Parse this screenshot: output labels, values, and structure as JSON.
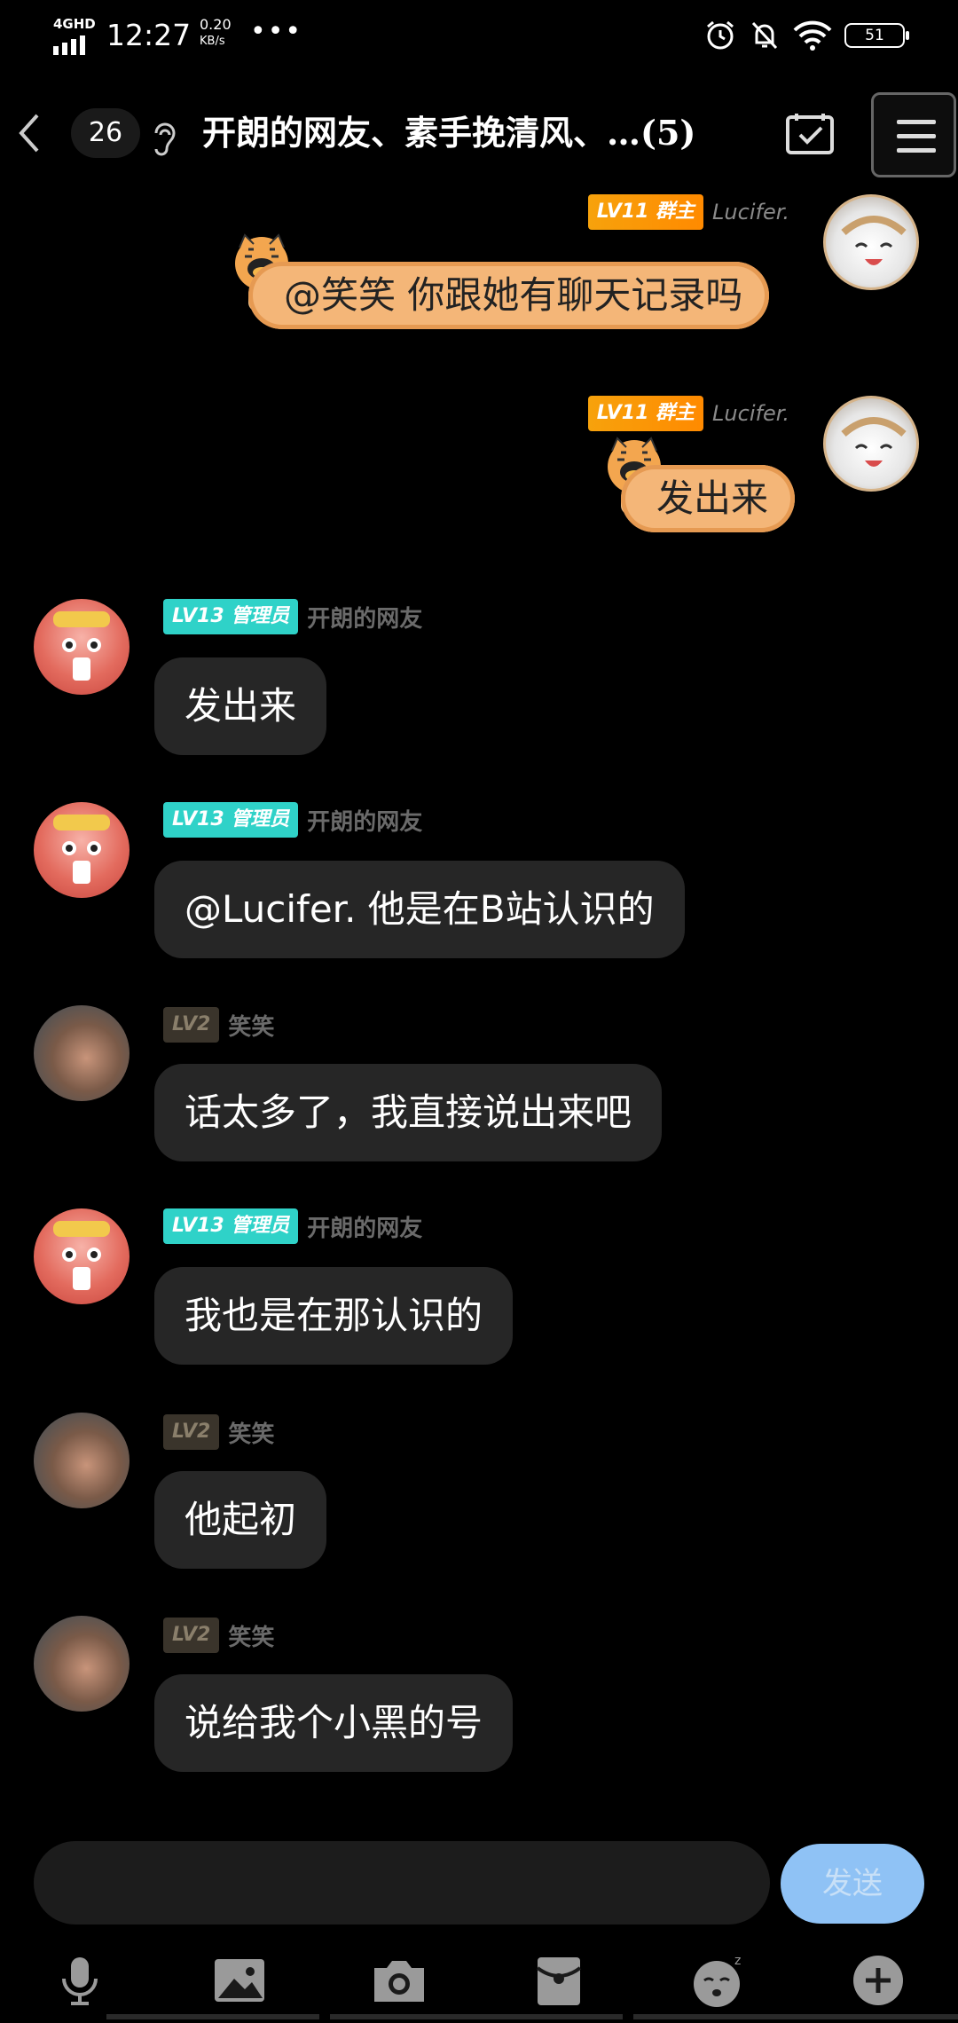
{
  "status_bar": {
    "network": "4GHD",
    "time": "12:27",
    "speed_value": "0.20",
    "speed_unit": "KB/s",
    "more": "•••",
    "battery": "51",
    "icons": [
      "alarm-icon",
      "mute-bell-icon",
      "wifi-icon",
      "battery-icon"
    ]
  },
  "nav": {
    "unread_count": "26",
    "title": "开朗的网友、素手挽清风、…(5)",
    "icons": [
      "back-arrow-icon",
      "ear-icon",
      "calendar-check-icon",
      "menu-icon"
    ]
  },
  "messages": [
    {
      "side": "right",
      "badge": "LV11 群主",
      "nick": "Lucifer.",
      "text": "@笑笑 你跟她有聊天记录吗",
      "style": "tiger"
    },
    {
      "side": "right",
      "badge": "LV11 群主",
      "nick": "Lucifer.",
      "text": "发出来",
      "style": "tiger"
    },
    {
      "side": "left",
      "badge": "LV13 管理员",
      "nick": "开朗的网友",
      "text": "发出来"
    },
    {
      "side": "left",
      "badge": "LV13 管理员",
      "nick": "开朗的网友",
      "text": "@Lucifer. 他是在B站认识的"
    },
    {
      "side": "left",
      "badge": "LV2",
      "nick": "笑笑",
      "text": "话太多了，我直接说出来吧"
    },
    {
      "side": "left",
      "badge": "LV13 管理员",
      "nick": "开朗的网友",
      "text": "我也是在那认识的"
    },
    {
      "side": "left",
      "badge": "LV2",
      "nick": "笑笑",
      "text": "他起初"
    },
    {
      "side": "left",
      "badge": "LV2",
      "nick": "笑笑",
      "text": "说给我个小黑的号"
    }
  ],
  "input": {
    "value": "",
    "send_label": "发送"
  },
  "toolbar": {
    "items": [
      "microphone-icon",
      "image-icon",
      "camera-icon",
      "red-packet-icon",
      "emoji-icon",
      "plus-icon"
    ]
  },
  "colors": {
    "background": "#000000",
    "bubble": "#262626",
    "admin_badge": "#2fd2c8",
    "owner_badge": "#ff8a00",
    "send_button": "#8fc2f5",
    "tiger_bubble": "#f4b678"
  }
}
